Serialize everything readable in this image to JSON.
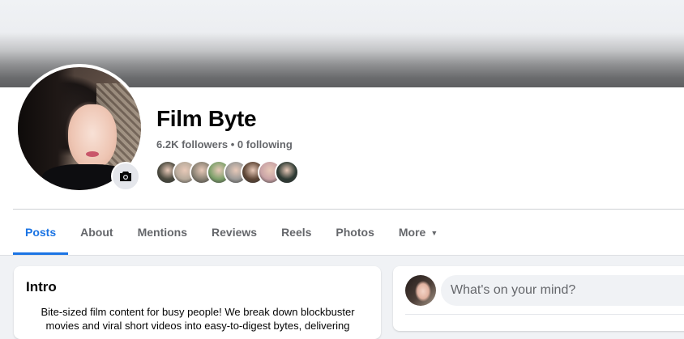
{
  "profile": {
    "name": "Film Byte",
    "stats": "6.2K followers • 0 following",
    "follower_avatars": [
      "#4b4a3f",
      "#b7aa9b",
      "#8a8274",
      "#7ea16b",
      "#9c9a97",
      "#5e4636",
      "#c9a3a6",
      "#2d3a33"
    ]
  },
  "tabs": [
    {
      "label": "Posts",
      "active": true
    },
    {
      "label": "About"
    },
    {
      "label": "Mentions"
    },
    {
      "label": "Reviews"
    },
    {
      "label": "Reels"
    },
    {
      "label": "Photos"
    },
    {
      "label": "More"
    }
  ],
  "intro": {
    "title": "Intro",
    "bio": "Bite-sized film content for busy people! We break down blockbuster movies and viral short videos into easy-to-digest bytes, delivering"
  },
  "composer": {
    "placeholder": "What's on your mind?"
  },
  "icons": {
    "camera": "camera-icon",
    "more_caret": "caret-down-icon"
  },
  "colors": {
    "accent": "#1b74e4",
    "muted_text": "#65676b",
    "page_bg": "#f0f2f5"
  }
}
